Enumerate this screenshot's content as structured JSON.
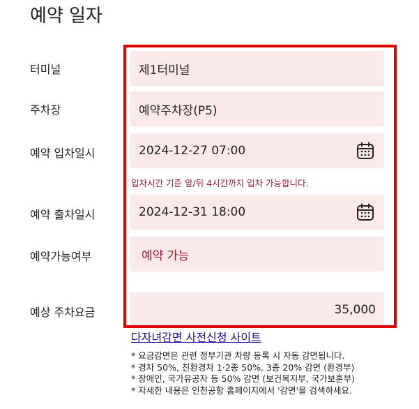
{
  "section_title": "예약 일자",
  "rows": {
    "terminal": {
      "label": "터미널",
      "value": "제1터미널"
    },
    "parking_lot": {
      "label": "주차장",
      "value": "예약주차장(P5)"
    },
    "entry": {
      "label": "예약 입차일시",
      "value": "2024-12-27 07:00",
      "icon": "calendar-icon"
    },
    "entry_hint": "입차시간 기준 앞/뒤 4시간까지 입차 가능합니다.",
    "exit": {
      "label": "예약 출차일시",
      "value": "2024-12-31 18:00",
      "icon": "calendar-icon"
    },
    "availability": {
      "label": "예약가능여부",
      "value": "예약 가능"
    },
    "fee": {
      "label": "예상 주차요금",
      "value": "35,000"
    }
  },
  "discount_link": "다자녀감면 사전신청 사이트",
  "notes": [
    "* 요금감면은 관련 정부기관 차량 등록 시 자동 감면됩니다.",
    "* 경차 50%, 친환경차 1·2종 50%, 3종 20% 감면 (환경부)",
    "* 장애인, 국가유공자 등 50% 감면 (보건복지부, 국가보훈부)",
    "* 자세한 내용은 인천공항 홈페이지에서 '감면'을 검색하세요."
  ],
  "colors": {
    "field_bg": "#fbe8e8",
    "highlight_border": "#e00000",
    "hint_text": "#9b1b2e",
    "link": "#1a0dab"
  }
}
